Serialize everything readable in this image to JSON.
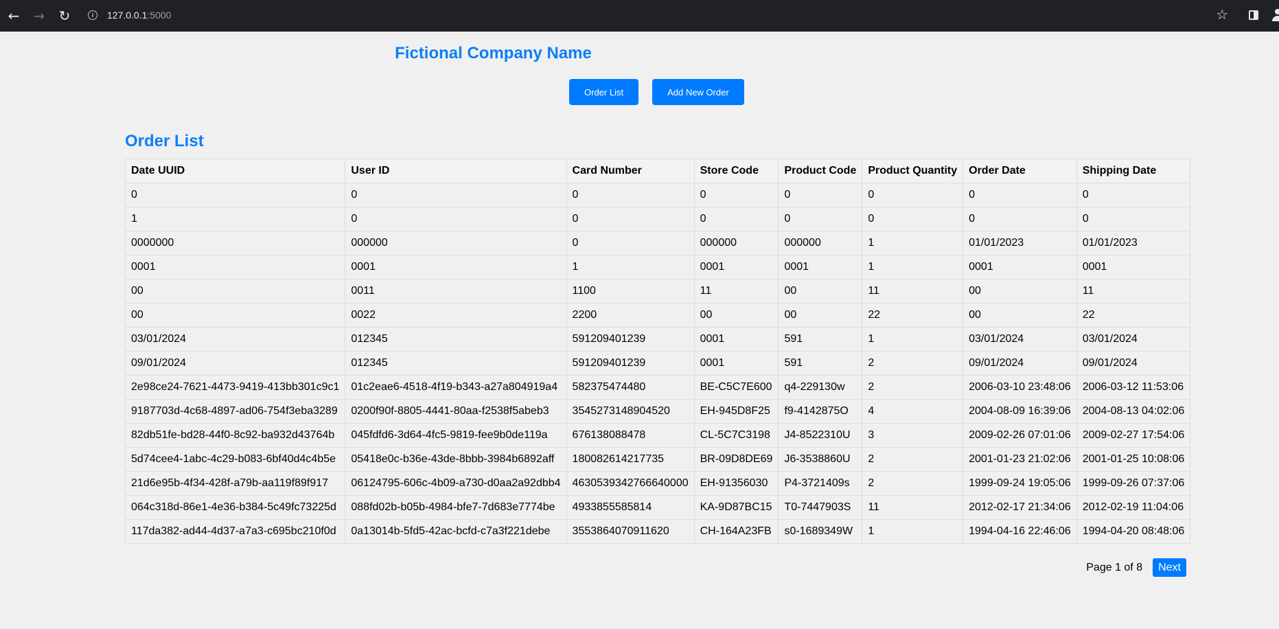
{
  "browser": {
    "url_host": "127.0.0.1",
    "url_port": ":5000"
  },
  "header": {
    "company_name": "Fictional Company Name",
    "nav": {
      "order_list_label": "Order List",
      "add_order_label": "Add New Order"
    }
  },
  "main": {
    "section_title": "Order List",
    "columns": [
      "Date UUID",
      "User ID",
      "Card Number",
      "Store Code",
      "Product Code",
      "Product Quantity",
      "Order Date",
      "Shipping Date"
    ],
    "rows": [
      [
        "0",
        "0",
        "0",
        "0",
        "0",
        "0",
        "0",
        "0"
      ],
      [
        "1",
        "0",
        "0",
        "0",
        "0",
        "0",
        "0",
        "0"
      ],
      [
        "0000000",
        "000000",
        "0",
        "000000",
        "000000",
        "1",
        "01/01/2023",
        "01/01/2023"
      ],
      [
        "0001",
        "0001",
        "1",
        "0001",
        "0001",
        "1",
        "0001",
        "0001"
      ],
      [
        "00",
        "0011",
        "1100",
        "11",
        "00",
        "11",
        "00",
        "11"
      ],
      [
        "00",
        "0022",
        "2200",
        "00",
        "00",
        "22",
        "00",
        "22"
      ],
      [
        "03/01/2024",
        "012345",
        "591209401239",
        "0001",
        "591",
        "1",
        "03/01/2024",
        "03/01/2024"
      ],
      [
        "09/01/2024",
        "012345",
        "591209401239",
        "0001",
        "591",
        "2",
        "09/01/2024",
        "09/01/2024"
      ],
      [
        "2e98ce24-7621-4473-9419-413bb301c9c1",
        "01c2eae6-4518-4f19-b343-a27a804919a4",
        "582375474480",
        "BE-C5C7E600",
        "q4-229130w",
        "2",
        "2006-03-10 23:48:06",
        "2006-03-12 11:53:06"
      ],
      [
        "9187703d-4c68-4897-ad06-754f3eba3289",
        "0200f90f-8805-4441-80aa-f2538f5abeb3",
        "3545273148904520",
        "EH-945D8F25",
        "f9-4142875O",
        "4",
        "2004-08-09 16:39:06",
        "2004-08-13 04:02:06"
      ],
      [
        "82db51fe-bd28-44f0-8c92-ba932d43764b",
        "045fdfd6-3d64-4fc5-9819-fee9b0de119a",
        "676138088478",
        "CL-5C7C3198",
        "J4-8522310U",
        "3",
        "2009-02-26 07:01:06",
        "2009-02-27 17:54:06"
      ],
      [
        "5d74cee4-1abc-4c29-b083-6bf40d4c4b5e",
        "05418e0c-b36e-43de-8bbb-3984b6892aff",
        "180082614217735",
        "BR-09D8DE69",
        "J6-3538860U",
        "2",
        "2001-01-23 21:02:06",
        "2001-01-25 10:08:06"
      ],
      [
        "21d6e95b-4f34-428f-a79b-aa119f89f917",
        "06124795-606c-4b09-a730-d0aa2a92dbb4",
        "4630539342766640000",
        "EH-91356030",
        "P4-3721409s",
        "2",
        "1999-09-24 19:05:06",
        "1999-09-26 07:37:06"
      ],
      [
        "064c318d-86e1-4e36-b384-5c49fc73225d",
        "088fd02b-b05b-4984-bfe7-7d683e7774be",
        "4933855585814",
        "KA-9D87BC15",
        "T0-7447903S",
        "11",
        "2012-02-17 21:34:06",
        "2012-02-19 11:04:06"
      ],
      [
        "117da382-ad44-4d37-a7a3-c695bc210f0d",
        "0a13014b-5fd5-42ac-bcfd-c7a3f221debe",
        "3553864070911620",
        "CH-164A23FB",
        "s0-1689349W",
        "1",
        "1994-04-16 22:46:06",
        "1994-04-20 08:48:06"
      ]
    ]
  },
  "pagination": {
    "page_text": "Page 1 of 8",
    "next_label": "Next"
  },
  "icons": {
    "back": "arrow-left-icon",
    "forward": "arrow-right-icon",
    "reload": "reload-icon",
    "site_info": "info-icon",
    "bookmark": "star-icon",
    "side_panel": "side-panel-icon",
    "profile": "profile-icon"
  },
  "colors": {
    "accent": "#007bff",
    "title": "#0a7ff5",
    "page_bg": "#f0f0f0",
    "browser_bar": "#202124"
  }
}
